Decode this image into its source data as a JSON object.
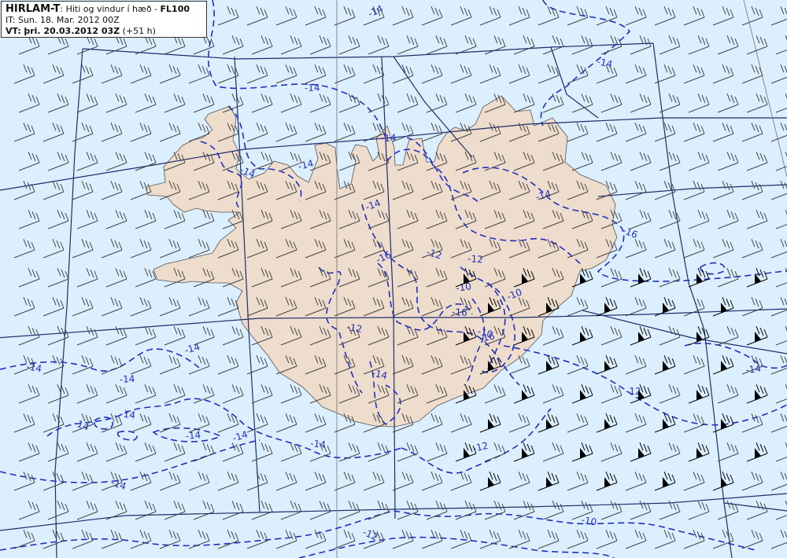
{
  "header": {
    "model": "HIRLAM-T",
    "title_sep": ": ",
    "description": "Hiti og vindur í hæð - ",
    "level": "FL100",
    "it_line": "IT: Sun. 18. Mar. 2012 00Z",
    "vt_label": "VT:",
    "vt_value": "þri. 20.03.2012 03Z",
    "lead_time": "(+51 h)"
  },
  "colors": {
    "sea": "#dcefff",
    "land": "#eedccc",
    "grid": "#1b2e6b",
    "contour": "#1f2fbf",
    "barb": "#444444",
    "strong_barb": "#000000"
  },
  "map": {
    "icon": "wind-barb-icon",
    "contour_labels": [
      "-14",
      "-14",
      "-14",
      "-14",
      "-14",
      "-14",
      "-14",
      "-14",
      "-14",
      "-14",
      "-14",
      "-14",
      "-14",
      "-14",
      "-14",
      "-14",
      "-12",
      "-12",
      "-10",
      "-10",
      "-10",
      "-16",
      "-16",
      "-16",
      "-14",
      "-12",
      "-12",
      "-12",
      "-10",
      "-14",
      "-14",
      "-16",
      "-12"
    ]
  }
}
